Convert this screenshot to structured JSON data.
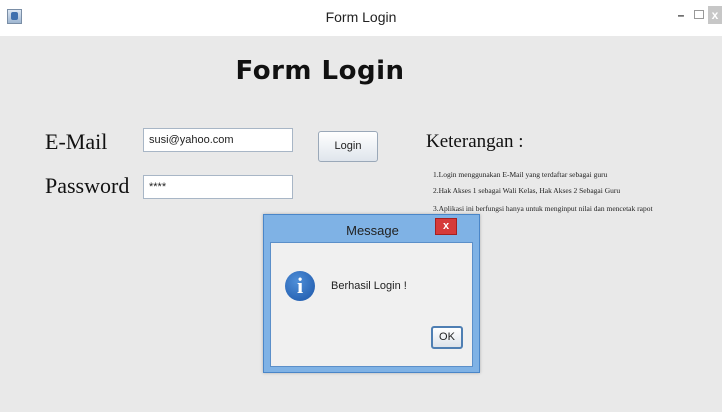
{
  "window": {
    "title": "Form Login",
    "minimize_label": "–",
    "close_label": "x"
  },
  "form": {
    "title": "Form Login",
    "email_label": "E-Mail",
    "email_value": "susi@yahoo.com",
    "password_label": "Password",
    "password_value": "****",
    "login_button": "Login"
  },
  "keterangan": {
    "title": "Keterangan :",
    "items": [
      "1.Login menggunakan E-Mail yang terdaftar sebagai guru",
      "2.Hak Akses 1 sebagai Wali Kelas, Hak Akses 2 Sebagai Guru",
      "3.Aplikasi ini berfungsi hanya untuk menginput nilai dan mencetak rapot"
    ]
  },
  "dialog": {
    "title": "Message",
    "close_label": "x",
    "icon": "info-icon",
    "icon_glyph": "i",
    "message": "Berhasil Login !",
    "ok_button": "OK"
  }
}
